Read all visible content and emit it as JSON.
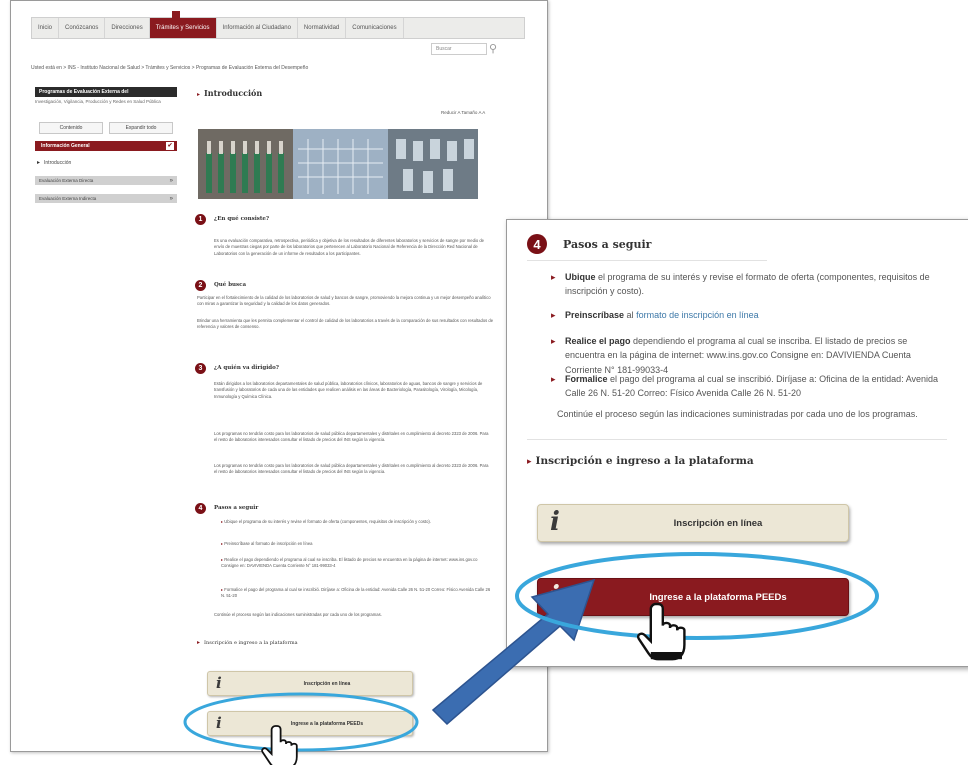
{
  "nav": {
    "items": [
      "Inicio",
      "Conózcanos",
      "Direcciones",
      "Trámites y Servicios",
      "Información al Ciudadano",
      "Normatividad",
      "Comunicaciones"
    ],
    "active_index": 3
  },
  "search": {
    "placeholder": "Buscar"
  },
  "breadcrumb": "Usted está en > INS - Instituto Nacional de Salud > Trámites y Servicios > Programas de Evaluación Externa del Desempeño",
  "sidebar": {
    "title": "Programas de Evaluación Externa del",
    "subtitle": "Investigación, Vigilancia, Producción y Redes en Salud Pública",
    "btn_left": "Contenido",
    "btn_right": "Expandir todo",
    "active_item": "Información General",
    "sub_item": "Introducción",
    "gray_items": [
      "Evaluación Externa Directa",
      "Evaluación Externa Indirecta"
    ]
  },
  "main": {
    "intro_title": "Introducción",
    "font_size_label": "Reducir A  Tamaño  A  A"
  },
  "sections": [
    {
      "num": "1",
      "title": "¿En qué consiste?",
      "body": "Es una evaluación comparativa, retrospectiva, periódica y objetiva de los resultados de diferentes laboratorios y servicios de sangre por medio de envío de muestras ciegas por parte de los laboratorios que pertenecen al Laboratorio Nacional de Referencia de la Dirección Red Nacional de Laboratorios con la generación de un informe de resultados a los participantes."
    },
    {
      "num": "2",
      "title": "Qué busca",
      "body": "Participar en el fortalecimiento de la calidad de los laboratorios de salud y bancos de sangre, promoviendo la mejora continua y un mejor desempeño analítico con miras a garantizar la seguridad y la calidad de los datos generados.",
      "body2": "Brindar una herramienta que les permita complementar el control de calidad de los laboratorios a través de la comparación de sus resultados con resultados de referencia y valores de consenso."
    },
    {
      "num": "3",
      "title": "¿A quién va dirigido?",
      "body": "Están dirigidos a los laboratorios departamentales de salud pública, laboratorios clínicos, laboratorios de aguas, bancos de sangre y servicios de transfusión y laboratorios de cada una de las entidades que realicen análisis en las áreas de Bacteriología, Parasitología, Virología, Micología, Inmunología y Química Clínica.",
      "body2": "Los programas no tendrán costo para los laboratorios de salud pública departamentales y distritales en cumplimiento al decreto 2323 de 2006. Para el resto de laboratorios interesados consultar el listado de precios del INS según la vigencia.",
      "body3": "Los programas no tendrán costo para los laboratorios de salud pública departamentales y distritales en cumplimiento al decreto 2323 de 2006. Para el resto de laboratorios interesados consultar el listado de precios del INS según la vigencia."
    },
    {
      "num": "4",
      "title": "Pasos a seguir",
      "items": [
        "Ubique el programa de su interés y revise el formato de oferta (componentes, requisitos de inscripción y costo).",
        "Preinscríbase al formato de inscripción en línea",
        "Realice el pago dependiendo el programa al cual se inscriba. El listado de precios se encuentra en la página de internet: www.ins.gov.co Consigne en: DAVIVIENDA Cuenta Corriente N° 181-99033-4",
        "Formalice el pago del programa al cual se inscribió. Diríjase a: Oficina de la entidad: Avenida Calle 26 N. 51-20 Correo: Físico Avenida Calle 26 N. 51-20"
      ],
      "continue": "Continúe el proceso según las indicaciones suministradas por cada uno de los programas."
    }
  ],
  "inscripcion_heading": "Inscripción e ingreso a la plataforma",
  "buttons": {
    "inscripcion": "Inscripción en línea",
    "ingrese": "Ingrese a la plataforma PEEDs",
    "icon_letter": "i"
  },
  "zoom": {
    "num": "4",
    "title": "Pasos a seguir",
    "items": [
      {
        "bold": "Ubique",
        "text": " el programa de su interés y revise el formato de oferta (componentes, requisitos de inscripción y costo)."
      },
      {
        "bold": "Preinscríbase",
        "text": " al ",
        "link": "formato de inscripción en línea"
      },
      {
        "bold": "Realice el pago",
        "text": " dependiendo el programa al cual se inscriba. El listado de precios se encuentra en la página de internet: www.ins.gov.co Consigne en: DAVIVIENDA Cuenta Corriente N° 181-99033-4"
      },
      {
        "bold": "Formalice",
        "text": " el pago del programa al cual se inscribió. Diríjase a: Oficina de la entidad: Avenida Calle 26 N. 51-20 Correo: Físico Avenida Calle 26 N. 51-20"
      }
    ],
    "continue": "Continúe el proceso según las indicaciones suministradas por cada uno de los programas.",
    "insc_heading": "Inscripción e ingreso a la plataforma",
    "btn1": "Inscripción en línea",
    "btn2": "Ingrese a la plataforma PEEDs"
  },
  "colors": {
    "accent": "#8a1a1f",
    "button_bg": "#ece7d6",
    "arrow": "#3b6db1",
    "ellipse": "#39a7dc",
    "link": "#3d78a8"
  }
}
